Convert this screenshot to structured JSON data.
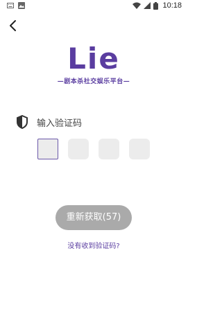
{
  "status_bar": {
    "time": "10:18",
    "icons": [
      "keyboard-icon",
      "image-icon",
      "wifi-icon",
      "signal-icon",
      "battery-icon"
    ]
  },
  "header": {
    "back_icon": "chevron-left-icon"
  },
  "logo": {
    "word": "Lie",
    "tagline": "—剧本杀社交娱乐平台—",
    "brand_color": "#5a3da0"
  },
  "verification": {
    "label": "输入验证码",
    "icon": "shield-icon",
    "boxes": [
      "",
      "",
      "",
      ""
    ]
  },
  "actions": {
    "resend_label": "重新获取(57)",
    "no_code_link": "没有收到验证码?"
  }
}
